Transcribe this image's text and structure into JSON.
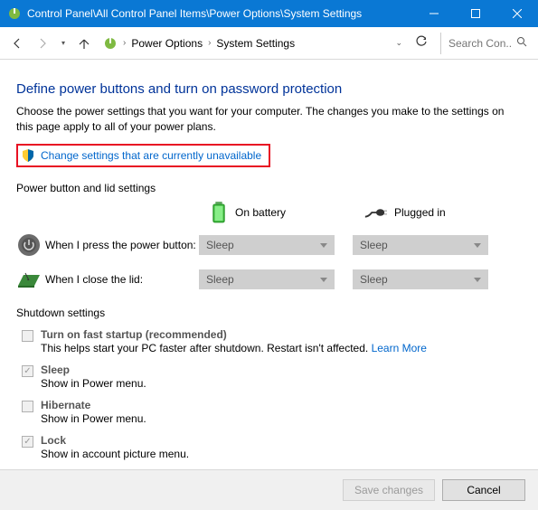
{
  "titlebar": {
    "text": "Control Panel\\All Control Panel Items\\Power Options\\System Settings"
  },
  "nav": {
    "crumb1": "Power Options",
    "crumb2": "System Settings",
    "search_placeholder": "Search Con..."
  },
  "page": {
    "heading": "Define power buttons and turn on password protection",
    "desc": "Choose the power settings that you want for your computer. The changes you make to the settings on this page apply to all of your power plans.",
    "change_link": "Change settings that are currently unavailable"
  },
  "section1": {
    "title": "Power button and lid settings",
    "col_battery": "On battery",
    "col_plugged": "Plugged in",
    "row1_label": "When I press the power button:",
    "row2_label": "When I close the lid:",
    "val": "Sleep"
  },
  "section2": {
    "title": "Shutdown settings",
    "opt1_label": "Turn on fast startup (recommended)",
    "opt1_sub": "This helps start your PC faster after shutdown. Restart isn't affected. ",
    "opt1_learn": "Learn More",
    "opt2_label": "Sleep",
    "opt2_sub": "Show in Power menu.",
    "opt3_label": "Hibernate",
    "opt3_sub": "Show in Power menu.",
    "opt4_label": "Lock",
    "opt4_sub": "Show in account picture menu."
  },
  "footer": {
    "save": "Save changes",
    "cancel": "Cancel"
  }
}
